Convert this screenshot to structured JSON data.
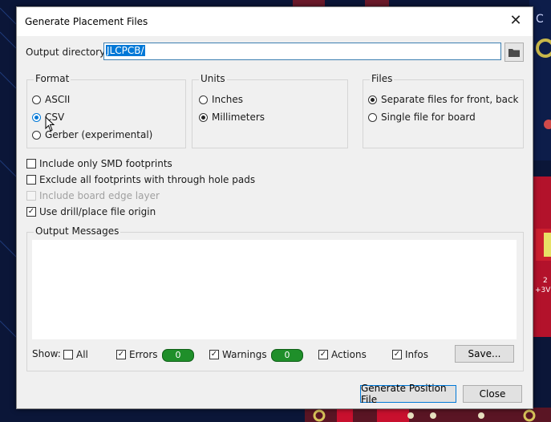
{
  "window": {
    "title": "Generate Placement Files"
  },
  "output_directory": {
    "label": "Output directory:",
    "value": "JLCPCB/"
  },
  "format": {
    "title": "Format",
    "options": [
      "ASCII",
      "CSV",
      "Gerber (experimental)"
    ],
    "selected": "CSV"
  },
  "units": {
    "title": "Units",
    "options": [
      "Inches",
      "Millimeters"
    ],
    "selected": "Millimeters"
  },
  "files": {
    "title": "Files",
    "options": [
      "Separate files for front, back",
      "Single file for board"
    ],
    "selected": "Separate files for front, back"
  },
  "checkboxes": [
    {
      "label": "Include only SMD footprints",
      "checked": false,
      "enabled": true
    },
    {
      "label": "Exclude all footprints with through hole pads",
      "checked": false,
      "enabled": true
    },
    {
      "label": "Include board edge layer",
      "checked": false,
      "enabled": false
    },
    {
      "label": "Use drill/place file origin",
      "checked": true,
      "enabled": true
    }
  ],
  "output_messages": {
    "title": "Output Messages",
    "show_label": "Show:",
    "filters": [
      {
        "label": "All",
        "checked": false
      },
      {
        "label": "Errors",
        "checked": true
      },
      {
        "label": "Warnings",
        "checked": true
      },
      {
        "label": "Actions",
        "checked": true
      },
      {
        "label": "Infos",
        "checked": true
      }
    ],
    "errors_count": "0",
    "warnings_count": "0",
    "save_label": "Save..."
  },
  "buttons": {
    "generate": "Generate Position File",
    "close": "Close"
  },
  "background": {
    "label_2": "2",
    "label_3v": "+3V",
    "corner_glyph": "C"
  },
  "icons": {
    "close": "close-icon",
    "browse": "folder-icon",
    "check": "checkmark-icon"
  },
  "colors": {
    "accent": "#0078d7",
    "badge": "#1f8f2a",
    "pcb_red": "#c8102e",
    "pcb_blue": "#0b1638"
  }
}
